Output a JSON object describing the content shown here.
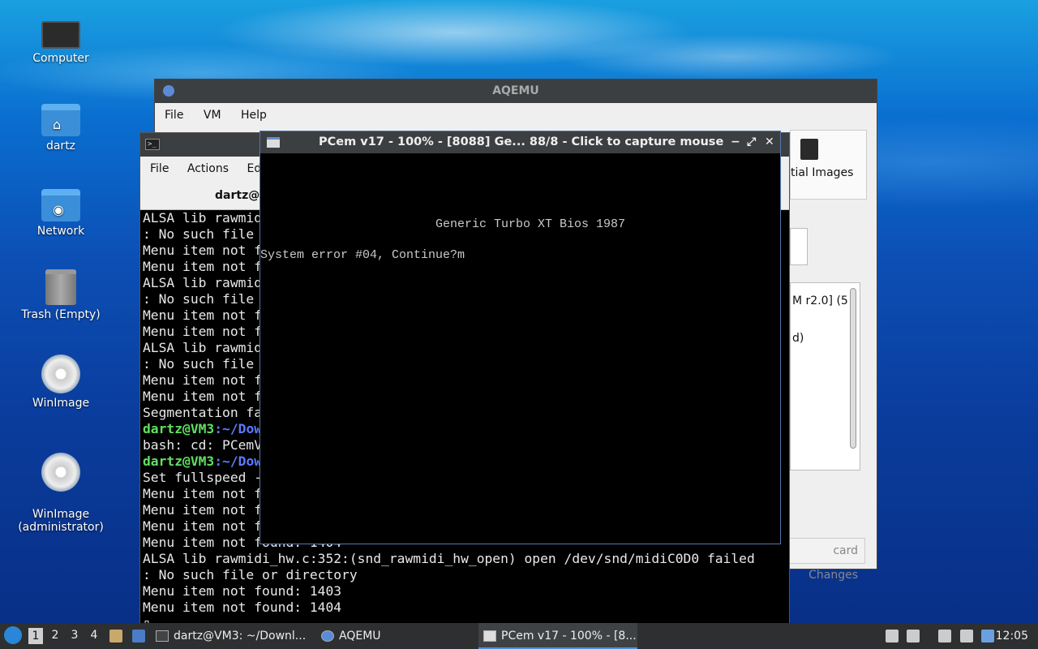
{
  "desktop": {
    "icons": [
      {
        "label": "Computer"
      },
      {
        "label": "dartz"
      },
      {
        "label": "Network"
      },
      {
        "label": "Trash (Empty)"
      },
      {
        "label": "WinImage"
      },
      {
        "label": "WinImage\n(administrator)"
      }
    ]
  },
  "aqemu": {
    "title": "AQEMU",
    "menu": [
      "File",
      "VM",
      "Help"
    ],
    "panel_label": "tial Images",
    "list_line1": "M r2.0] (5",
    "list_line2": "d)",
    "discard_label": "card Changes"
  },
  "terminal": {
    "menu": [
      "File",
      "Actions",
      "Edi"
    ],
    "tab_title": "dartz@V",
    "lines": [
      {
        "text": "ALSA lib rawmid"
      },
      {
        "text": ": No such file"
      },
      {
        "text": "Menu item not f"
      },
      {
        "text": "Menu item not f"
      },
      {
        "text": "ALSA lib rawmid"
      },
      {
        "text": ": No such file"
      },
      {
        "text": "Menu item not f"
      },
      {
        "text": "Menu item not f"
      },
      {
        "text": "ALSA lib rawmid"
      },
      {
        "text": ": No such file"
      },
      {
        "text": "Menu item not f"
      },
      {
        "text": "Menu item not f"
      },
      {
        "text": "Segmentation fa"
      },
      {
        "user": "dartz@VM3",
        "path": ":~/Dow"
      },
      {
        "text": "bash: cd: PCemV"
      },
      {
        "user": "dartz@VM3",
        "path": ":~/Dow"
      },
      {
        "text": "Set fullspeed -"
      },
      {
        "text": "Menu item not f"
      },
      {
        "text": "Menu item not f"
      },
      {
        "text": "Menu item not f"
      },
      {
        "text": "Menu item not found: 1404"
      },
      {
        "text": "ALSA lib rawmidi_hw.c:352:(snd_rawmidi_hw_open) open /dev/snd/midiC0D0 failed"
      },
      {
        "text": ": No such file or directory"
      },
      {
        "text": "Menu item not found: 1403"
      },
      {
        "text": "Menu item not found: 1404"
      },
      {
        "text": "▯"
      }
    ]
  },
  "pcem": {
    "title": "PCem v17 - 100% - [8088] Ge... 88/8 - Click to capture mouse",
    "controls": [
      "−",
      "⤢",
      "✕"
    ],
    "bios_line1": "Generic Turbo XT Bios 1987",
    "bios_line2": "System error #04, Continue?m"
  },
  "taskbar": {
    "workspaces": [
      "1",
      "2",
      "3",
      "4"
    ],
    "items": [
      {
        "label": "dartz@VM3: ~/Downl..."
      },
      {
        "label": "AQEMU"
      },
      {
        "label": "PCem v17 - 100% - [8..."
      }
    ],
    "clock": "12:05"
  }
}
